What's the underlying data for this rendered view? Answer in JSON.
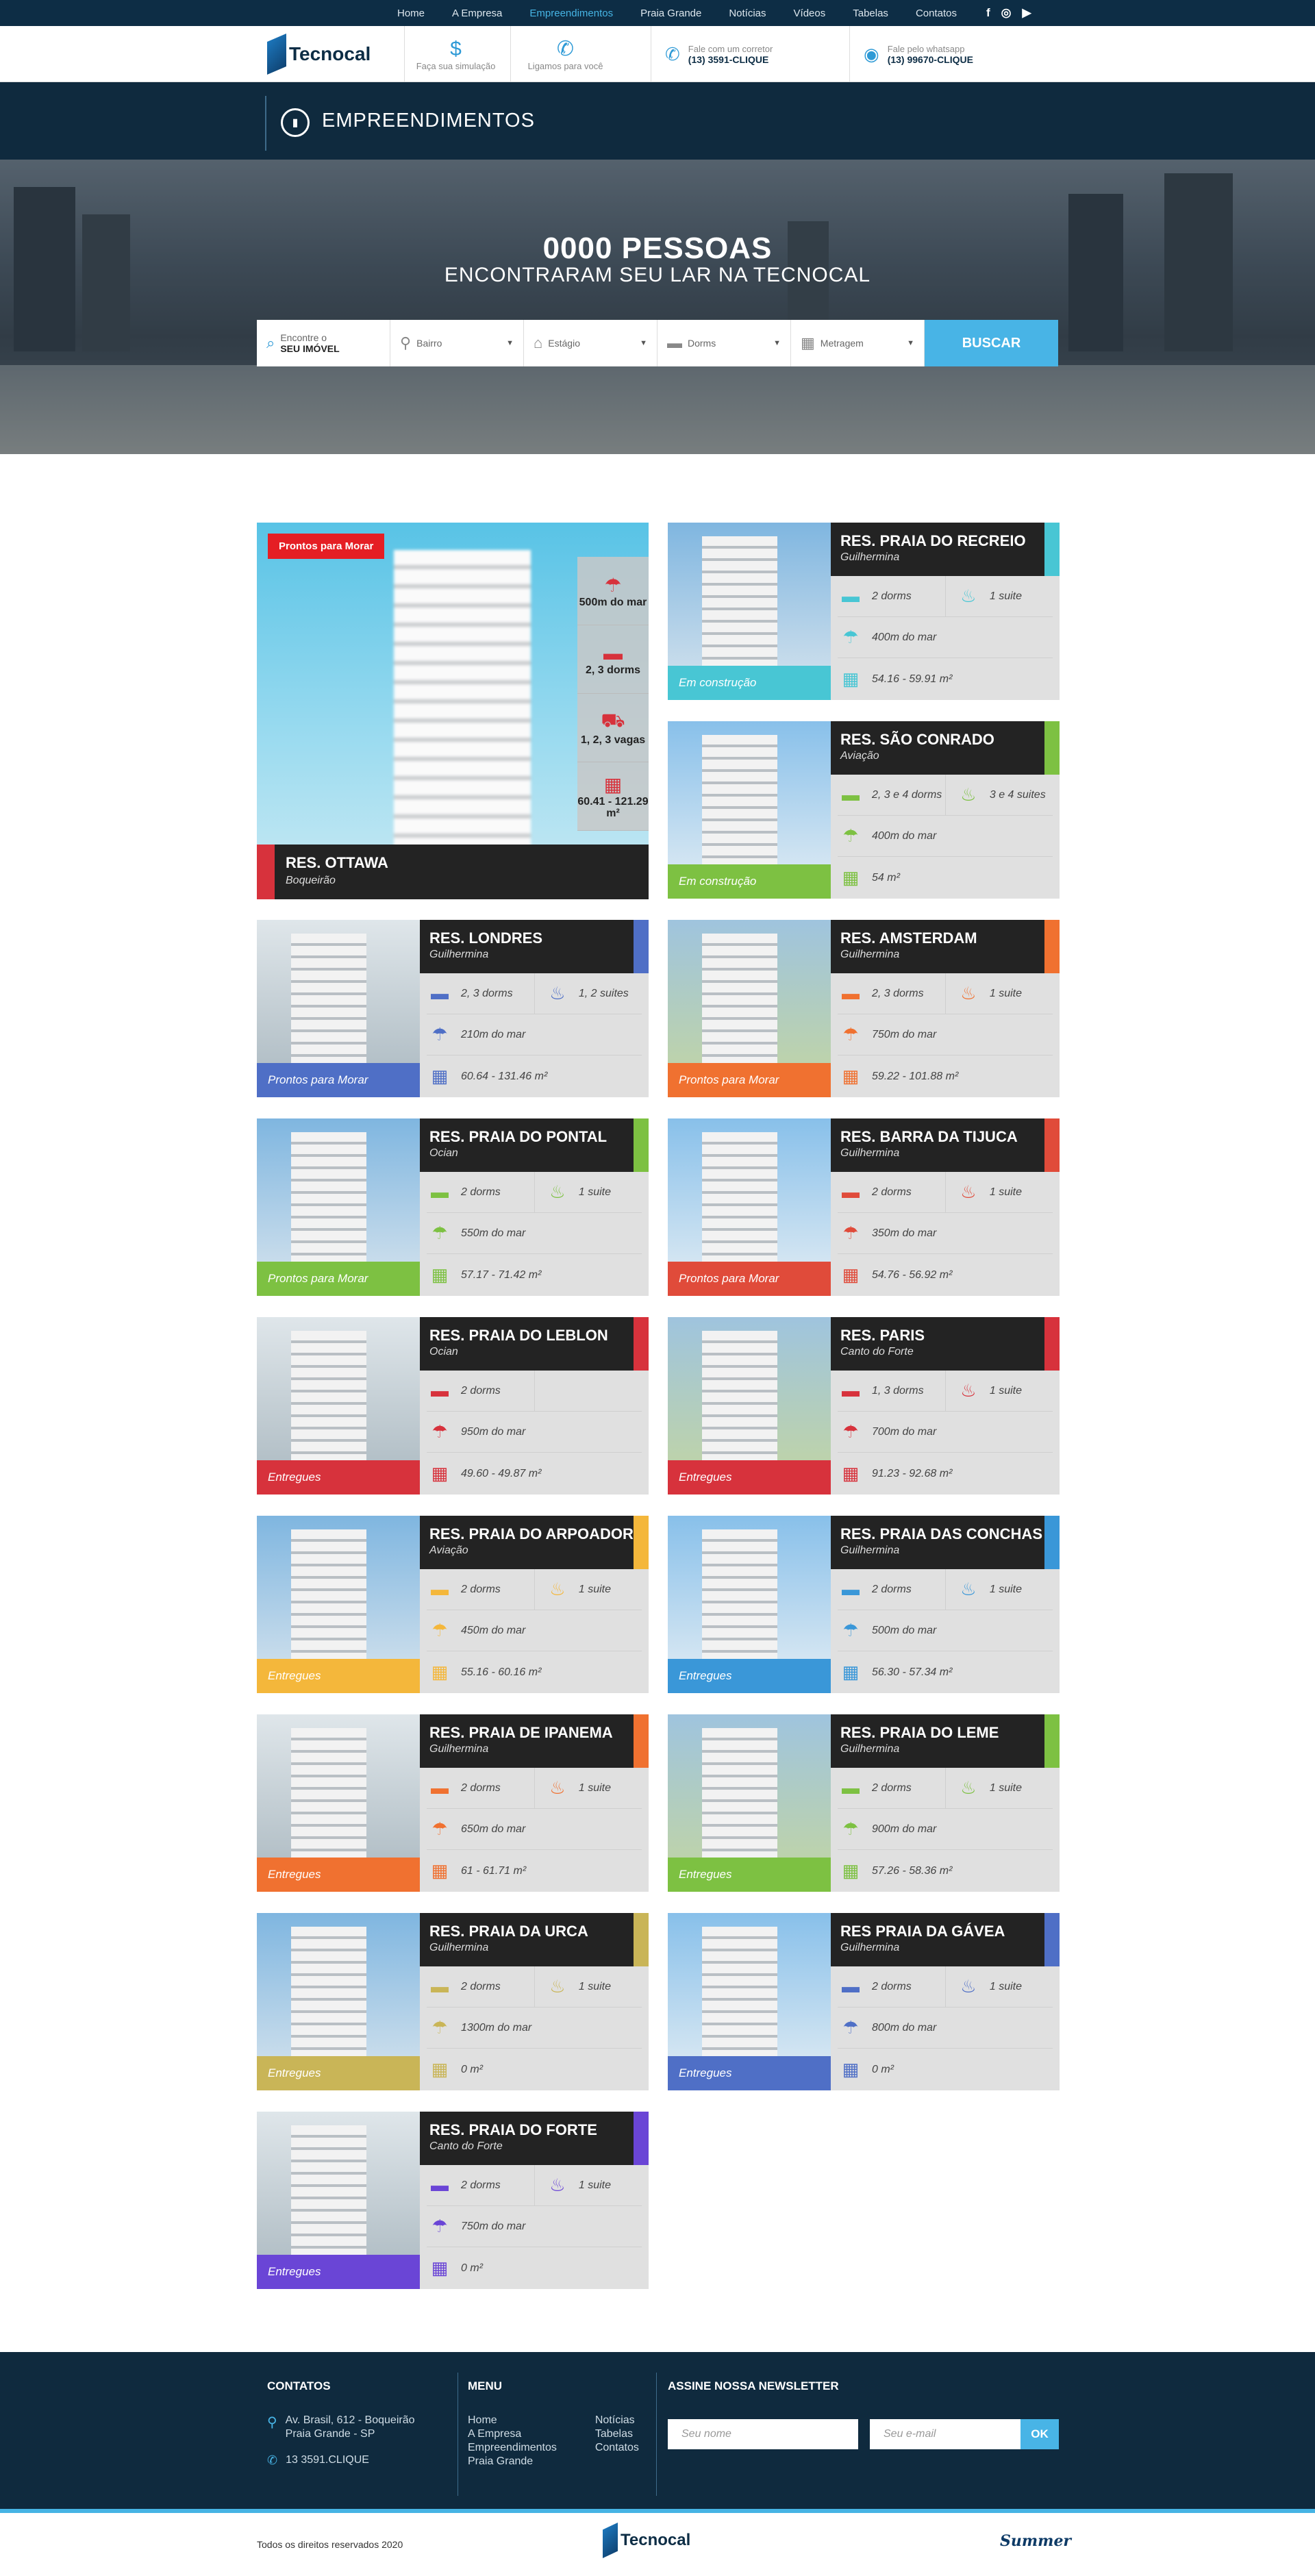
{
  "topnav": {
    "items": [
      "Home",
      "A Empresa",
      "Empreendimentos",
      "Praia Grande",
      "Notícias",
      "Vídeos",
      "Tabelas",
      "Contatos"
    ],
    "active": 2
  },
  "social": [
    "f",
    "ig",
    "yt"
  ],
  "header": {
    "logo": "Tecnocal",
    "simulacao": "Faça sua simulação",
    "ligamos": "Ligamos para você",
    "corretor_label": "Fale com um corretor",
    "corretor_phone": "(13) 3591-CLIQUE",
    "whatsapp_label": "Fale pelo whatsapp",
    "whatsapp_phone": "(13) 99670-CLIQUE"
  },
  "page_title": "EMPREENDIMENTOS",
  "hero": {
    "line1": "0000 PESSOAS",
    "line2": "ENCONTRARAM SEU LAR NA TECNOCAL"
  },
  "search": {
    "f1_small": "Encontre o",
    "f1_bold": "SEU IMÓVEL",
    "bairro": "Bairro",
    "estagio": "Estágio",
    "dorms": "Dorms",
    "metragem": "Metragem",
    "button": "BUSCAR"
  },
  "featured": {
    "badge": "Prontos para Morar",
    "name": "RES. OTTAWA",
    "bairro": "Boqueirão",
    "mar": "500m do mar",
    "dorms": "2, 3 dorms",
    "vagas": "1, 2, 3 vagas",
    "area": "60.41 - 121.29 m²",
    "accent": "#d7323c"
  },
  "cards": [
    {
      "name": "RES. PRAIA DO RECREIO",
      "bairro": "Guilhermina",
      "dorms": "2 dorms",
      "suites": "1 suite",
      "mar": "400m do mar",
      "area": "54.16 - 59.91 m²",
      "status": "Em construção",
      "color": "#48c6d4"
    },
    {
      "name": "RES. SÃO CONRADO",
      "bairro": "Aviação",
      "dorms": "2, 3 e 4 dorms",
      "suites": "3 e 4 suites",
      "mar": "400m do mar",
      "area": "54 m²",
      "status": "Em construção",
      "color": "#7dc142"
    },
    {
      "name": "RES. LONDRES",
      "bairro": "Guilhermina",
      "dorms": "2, 3 dorms",
      "suites": "1, 2 suites",
      "mar": "210m do mar",
      "area": "60.64 - 131.46 m²",
      "status": "Prontos para Morar",
      "color": "#4f6fc6"
    },
    {
      "name": "RES. AMSTERDAM",
      "bairro": "Guilhermina",
      "dorms": "2, 3 dorms",
      "suites": "1 suite",
      "mar": "750m do mar",
      "area": "59.22 - 101.88 m²",
      "status": "Prontos para Morar",
      "color": "#f07130"
    },
    {
      "name": "RES. PRAIA DO PONTAL",
      "bairro": "Ocian",
      "dorms": "2 dorms",
      "suites": "1 suite",
      "mar": "550m do mar",
      "area": "57.17 - 71.42 m²",
      "status": "Prontos para Morar",
      "color": "#7dc142"
    },
    {
      "name": "RES. BARRA DA TIJUCA",
      "bairro": "Guilhermina",
      "dorms": "2 dorms",
      "suites": "1 suite",
      "mar": "350m do mar",
      "area": "54.76 - 56.92 m²",
      "status": "Prontos para Morar",
      "color": "#e04b3a"
    },
    {
      "name": "RES. PRAIA DO LEBLON",
      "bairro": "Ocian",
      "dorms": "2 dorms",
      "suites": "",
      "mar": "950m do mar",
      "area": "49.60 - 49.87 m²",
      "status": "Entregues",
      "color": "#d7323c"
    },
    {
      "name": "RES. PARIS",
      "bairro": "Canto do Forte",
      "dorms": "1, 3 dorms",
      "suites": "1 suite",
      "mar": "700m do mar",
      "area": "91.23 - 92.68 m²",
      "status": "Entregues",
      "color": "#d7323c"
    },
    {
      "name": "RES. PRAIA DO ARPOADOR",
      "bairro": "Aviação",
      "dorms": "2 dorms",
      "suites": "1 suite",
      "mar": "450m do mar",
      "area": "55.16 - 60.16 m²",
      "status": "Entregues",
      "color": "#f4b73b"
    },
    {
      "name": "RES. PRAIA DAS CONCHAS",
      "bairro": "Guilhermina",
      "dorms": "2 dorms",
      "suites": "1 suite",
      "mar": "500m do mar",
      "area": "56.30 - 57.34 m²",
      "status": "Entregues",
      "color": "#3a97d8"
    },
    {
      "name": "RES. PRAIA DE IPANEMA",
      "bairro": "Guilhermina",
      "dorms": "2 dorms",
      "suites": "1 suite",
      "mar": "650m do mar",
      "area": "61 - 61.71 m²",
      "status": "Entregues",
      "color": "#f07130"
    },
    {
      "name": "RES. PRAIA DO LEME",
      "bairro": "Guilhermina",
      "dorms": "2 dorms",
      "suites": "1 suite",
      "mar": "900m do mar",
      "area": "57.26 - 58.36 m²",
      "status": "Entregues",
      "color": "#7dc142"
    },
    {
      "name": "RES. PRAIA DA URCA",
      "bairro": "Guilhermina",
      "dorms": "2 dorms",
      "suites": "1 suite",
      "mar": "1300m do mar",
      "area": "0 m²",
      "status": "Entregues",
      "color": "#c9b557"
    },
    {
      "name": "RES PRAIA DA GÁVEA",
      "bairro": "Guilhermina",
      "dorms": "2 dorms",
      "suites": "1 suite",
      "mar": "800m do mar",
      "area": "0 m²",
      "status": "Entregues",
      "color": "#4f6fc6"
    },
    {
      "name": "RES. PRAIA DO FORTE",
      "bairro": "Canto do Forte",
      "dorms": "2 dorms",
      "suites": "1 suite",
      "mar": "750m do mar",
      "area": "0 m²",
      "status": "Entregues",
      "color": "#6a45d6"
    }
  ],
  "footer": {
    "contatos_title": "CONTATOS",
    "address1": "Av. Brasil, 612 - Boqueirão",
    "address2": "Praia Grande - SP",
    "phone": "13 3591.CLIQUE",
    "menu_title": "MENU",
    "menu_col1": [
      "Home",
      "A Empresa",
      "Empreendimentos",
      "Praia Grande"
    ],
    "menu_col2": [
      "Notícias",
      "Tabelas",
      "Contatos"
    ],
    "news_title": "ASSINE NOSSA NEWSLETTER",
    "nome_placeholder": "Seu nome",
    "email_placeholder": "Seu e-mail",
    "ok": "OK",
    "copyright": "Todos os direitos reservados 2020",
    "signature": "Summer"
  }
}
